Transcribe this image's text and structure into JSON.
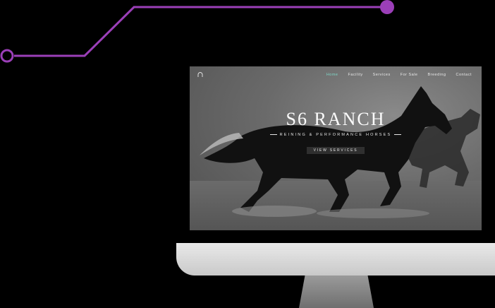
{
  "site": {
    "logo_icon": "horseshoe-icon",
    "nav": [
      "Home",
      "Facility",
      "Services",
      "For Sale",
      "Breeding",
      "Contact"
    ],
    "active_nav": "Home",
    "hero_title": "S6 RANCH",
    "hero_subtitle": "REINING & PERFORMANCE HORSES",
    "hero_button": "VIEW SERVICES"
  },
  "colors": {
    "circuit": "#9b3fb8",
    "nav_active": "#7fd7c7"
  }
}
